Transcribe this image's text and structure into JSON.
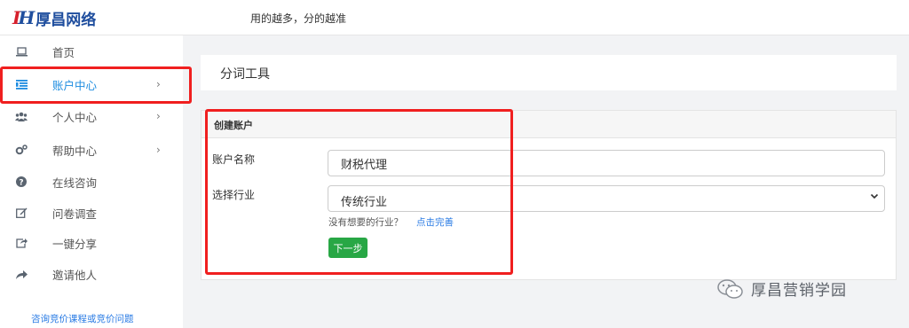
{
  "header": {
    "logo_mark": "H",
    "logo_text": "厚昌网络",
    "slogan": "用的越多，分的越准"
  },
  "sidebar": {
    "items": [
      {
        "label": "首页",
        "icon": "laptop-icon",
        "chevron": ""
      },
      {
        "label": "账户中心",
        "icon": "list-icon",
        "chevron": "›",
        "active": true
      },
      {
        "label": "个人中心",
        "icon": "users-icon",
        "chevron": "›"
      },
      {
        "label": "帮助中心",
        "icon": "cogs-icon",
        "chevron": "›"
      },
      {
        "label": "在线咨询",
        "icon": "question-circle-icon",
        "chevron": ""
      },
      {
        "label": "问卷调查",
        "icon": "edit-icon",
        "chevron": ""
      },
      {
        "label": "一键分享",
        "icon": "share-square-icon",
        "chevron": ""
      },
      {
        "label": "邀请他人",
        "icon": "share-arrow-icon",
        "chevron": ""
      }
    ],
    "bottom_link": "咨询竞价课程或竞价问题"
  },
  "main": {
    "title": "分词工具",
    "panel": {
      "heading": "创建账户",
      "account_name_label": "账户名称",
      "account_name_value": "财税代理",
      "industry_label": "选择行业",
      "industry_value": "传统行业",
      "hint_text": "没有想要的行业？",
      "hint_link": "点击完善",
      "next_button": "下一步"
    }
  },
  "watermark": {
    "text": "厚昌营销学园"
  },
  "colors": {
    "accent": "#1d8ce0",
    "primary_button": "#28a745",
    "annotation_red": "#f01f1f",
    "logo_blue": "#1f4e9e",
    "logo_red": "#d6202c"
  }
}
